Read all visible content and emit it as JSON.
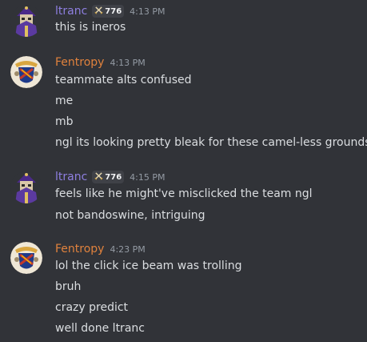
{
  "colors": {
    "background": "#313338",
    "ltranc_name": "#8e7fe0",
    "fentropy_name": "#e0823d",
    "timestamp": "#949ba4",
    "text": "#dbdee1"
  },
  "groups": [
    {
      "author": "ltranc",
      "badge": "776",
      "badge_icon": "crossed-swords-icon",
      "time": "4:13 PM",
      "lines": [
        "this is ineros"
      ]
    },
    {
      "author": "Fentropy",
      "time": "4:13 PM",
      "lines": [
        "teammate alts confused",
        "me",
        "mb",
        "ngl its looking pretty bleak for these camel-less grounds"
      ]
    },
    {
      "author": "ltranc",
      "badge": "776",
      "badge_icon": "crossed-swords-icon",
      "time": "4:15 PM",
      "lines": [
        "feels like he might've misclicked the team ngl",
        "not bandoswine, intriguing"
      ]
    },
    {
      "author": "Fentropy",
      "time": "4:23 PM",
      "lines": [
        "lol the click ice beam was trolling",
        "bruh",
        "crazy predict",
        "well done ltranc"
      ]
    }
  ]
}
